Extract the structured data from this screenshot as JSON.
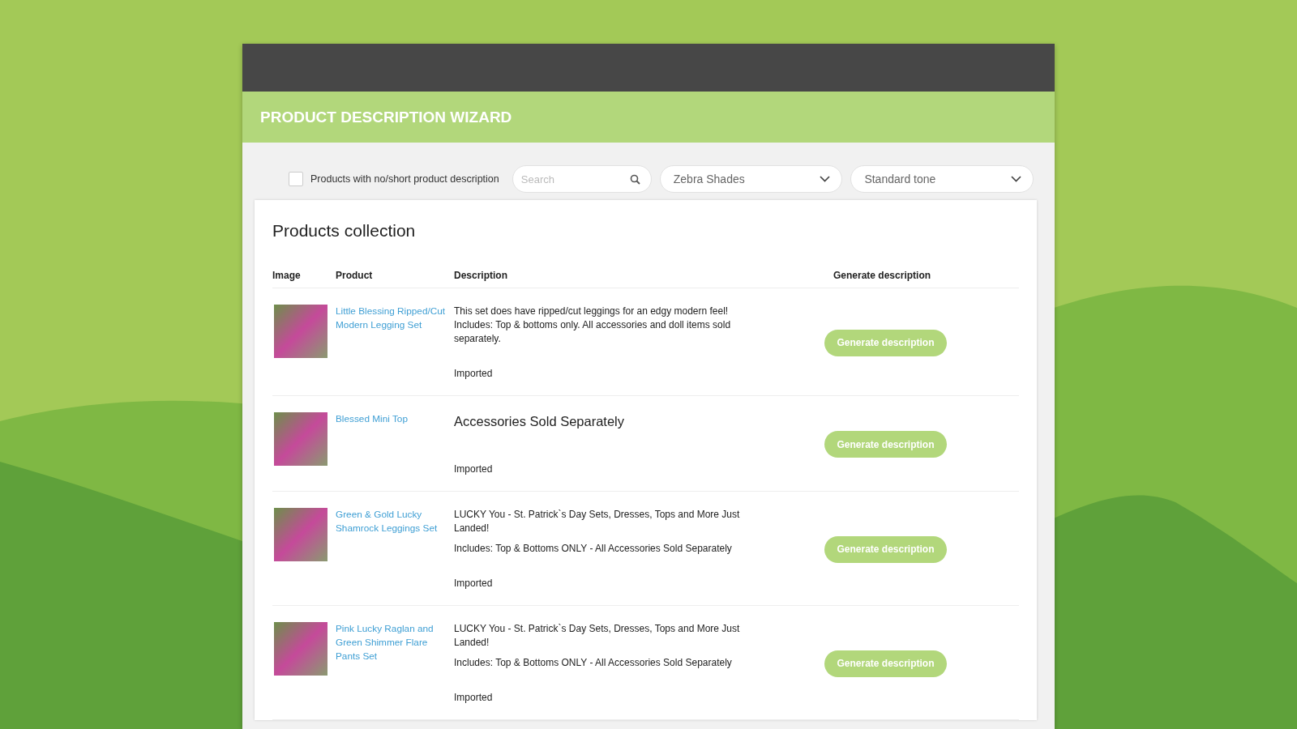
{
  "window": {
    "title": "PRODUCT DESCRIPTION WIZARD"
  },
  "filters": {
    "short_only": {
      "label": "Products with no/short product description",
      "checked": false
    },
    "search": {
      "placeholder": "Search"
    },
    "collection": {
      "value": "Zebra Shades"
    },
    "tone": {
      "value": "Standard tone"
    }
  },
  "card": {
    "title": "Products collection"
  },
  "table": {
    "columns": [
      "Image",
      "Product",
      "Description",
      "Generate description"
    ],
    "rows": [
      {
        "product": "Little Blessing Ripped/Cut Modern Legging Set",
        "description": [
          {
            "kind": "text",
            "text": "This set does have ripped/cut leggings for an edgy modern feel! Includes: Top & bottoms only. All accessories and doll items sold separately."
          },
          {
            "kind": "text",
            "text": "Imported"
          }
        ],
        "button": "Generate description"
      },
      {
        "product": "Blessed Mini Top",
        "description": [
          {
            "kind": "heading",
            "text": "Accessories Sold Separately"
          },
          {
            "kind": "text",
            "text": "Imported"
          }
        ],
        "button": "Generate description"
      },
      {
        "product": "Green & Gold Lucky Shamrock Leggings Set",
        "description": [
          {
            "kind": "text",
            "text": "LUCKY You - St. Patrick`s Day Sets, Dresses, Tops and More Just Landed!"
          },
          {
            "kind": "text",
            "text": "Includes: Top & Bottoms ONLY - All Accessories Sold Separately"
          },
          {
            "kind": "text",
            "text": "Imported"
          }
        ],
        "button": "Generate description"
      },
      {
        "product": "Pink Lucky Raglan and Green Shimmer Flare Pants Set",
        "description": [
          {
            "kind": "text",
            "text": "LUCKY You - St. Patrick`s Day Sets, Dresses, Tops and More Just Landed!"
          },
          {
            "kind": "text",
            "text": "Includes: Top & Bottoms ONLY - All Accessories Sold Separately"
          },
          {
            "kind": "text",
            "text": "Imported"
          }
        ],
        "button": "Generate description"
      }
    ]
  }
}
